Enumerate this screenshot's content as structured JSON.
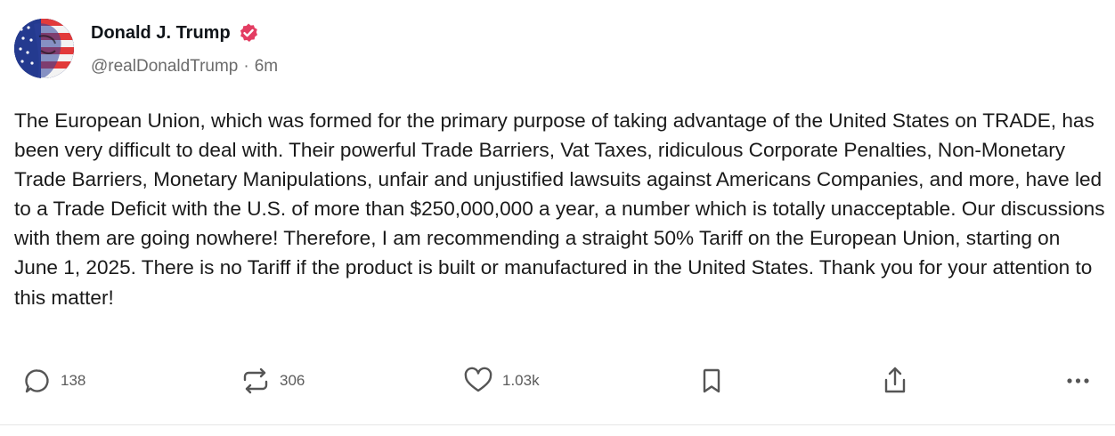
{
  "post": {
    "author_name": "Donald J. Trump",
    "handle": "@realDonaldTrump",
    "separator": "·",
    "time_ago": "6m",
    "text": "The European Union, which was formed for the primary purpose of taking advantage of the United States on TRADE, has been very difficult to deal with. Their powerful Trade Barriers, Vat Taxes, ridiculous Corporate Penalties, Non-Monetary Trade Barriers, Monetary Manipulations, unfair and unjustified lawsuits against Americans Companies, and more, have led to a Trade Deficit with the U.S. of more than $250,000,000 a year, a number which is totally unacceptable. Our discussions with them are going nowhere! Therefore, I am recommending a straight 50% Tariff on the European Union, starting on June 1, 2025. There is no Tariff if the product is built or manufactured in the United States. Thank you for your attention to this matter!"
  },
  "actions": {
    "replies": {
      "icon": "reply-icon",
      "count": "138"
    },
    "retruths": {
      "icon": "retruth-icon",
      "count": "306"
    },
    "likes": {
      "icon": "heart-icon",
      "count": "1.03k"
    },
    "bookmark": {
      "icon": "bookmark-icon"
    },
    "share": {
      "icon": "share-icon"
    },
    "more": {
      "icon": "more-icon"
    }
  },
  "colors": {
    "verified_badge": "#e33d62",
    "text": "#1a1a1a",
    "muted": "#6b6b6b",
    "icon": "#555555"
  }
}
